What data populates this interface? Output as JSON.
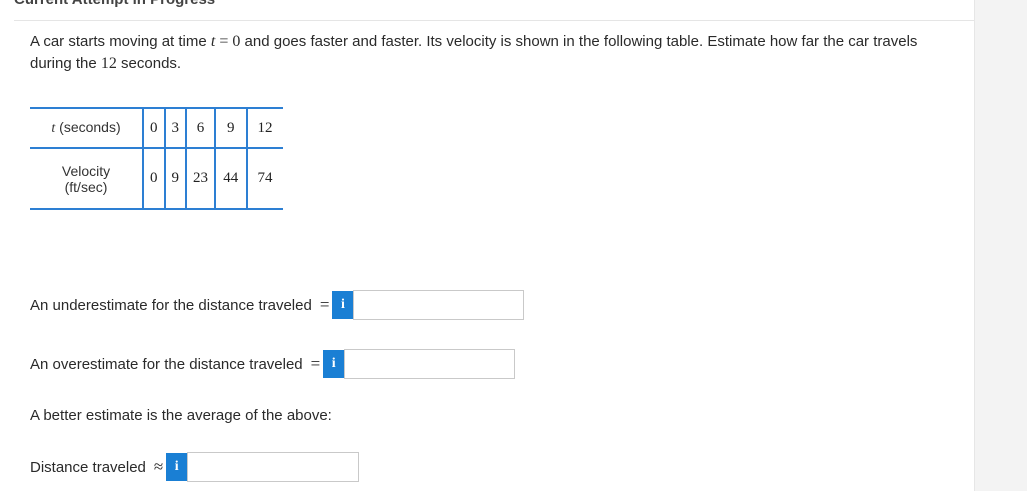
{
  "header": {
    "status": "Current Attempt in Progress"
  },
  "problem": {
    "part1": "A car starts moving at time ",
    "var_t": "t",
    "eq": " = 0",
    "part2": " and goes faster and faster. Its velocity is shown in the following table. Estimate how far the car travels during the ",
    "num12": "12",
    "part3": " seconds."
  },
  "table": {
    "row1_label_var": "t",
    "row1_label_rest": " (seconds)",
    "times": [
      "0",
      "3",
      "6",
      "9",
      "12"
    ],
    "row2_label_line1": "Velocity",
    "row2_label_line2": "(ft/sec)",
    "velocities": [
      "0",
      "9",
      "23",
      "44",
      "74"
    ]
  },
  "questions": {
    "under_label": "An underestimate for the distance traveled",
    "under_rel": "=",
    "over_label": "An overestimate for the distance traveled",
    "over_rel": "=",
    "better_text": "A better estimate is the average of the above:",
    "distance_label": "Distance traveled",
    "distance_rel": "≈",
    "info_glyph": "i"
  },
  "inputs": {
    "under_value": "",
    "over_value": "",
    "distance_value": ""
  },
  "colors": {
    "accent": "#1a7fd4",
    "table_border": "#2d7fd3"
  }
}
